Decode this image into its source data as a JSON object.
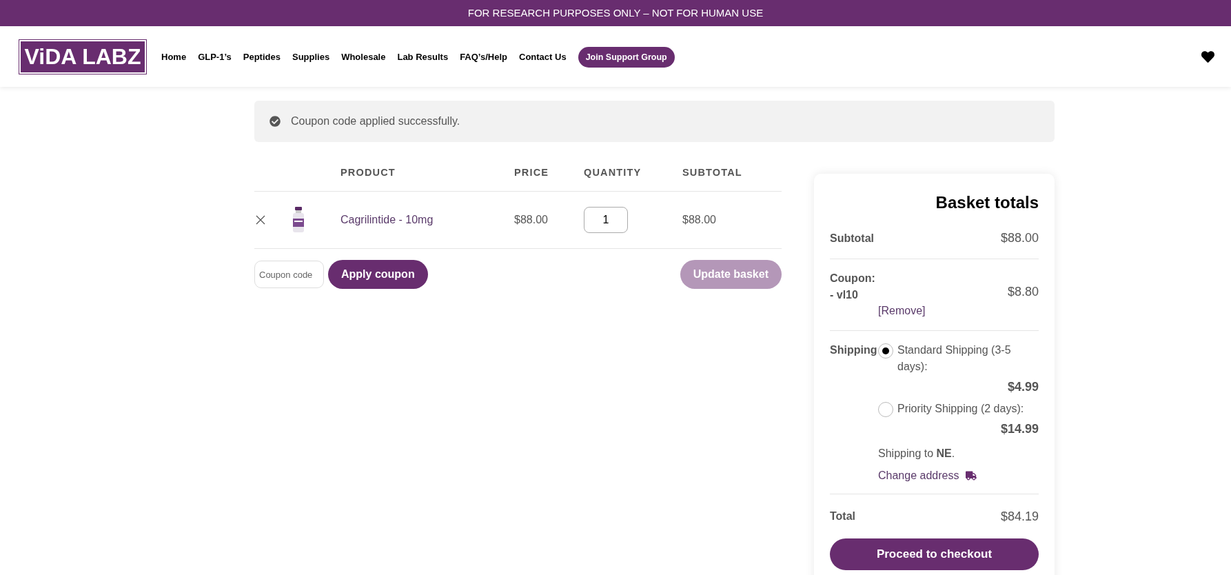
{
  "banner": "FOR RESEARCH PURPOSES ONLY – NOT FOR HUMAN USE",
  "logo": "ViDA LABZ",
  "nav": [
    {
      "label": "Home"
    },
    {
      "label": "GLP-1’s"
    },
    {
      "label": "Peptides"
    },
    {
      "label": "Supplies"
    },
    {
      "label": "Wholesale"
    },
    {
      "label": "Lab Results"
    },
    {
      "label": "FAQ’s/Help"
    },
    {
      "label": "Contact Us"
    }
  ],
  "nav_button": "Join Support Group",
  "notice": "Coupon code applied successfully.",
  "cart": {
    "columns": [
      "PRODUCT",
      "PRICE",
      "QUANTITY",
      "SUBTOTAL"
    ],
    "rows": [
      {
        "product": "Cagrilintide - 10mg",
        "price": "$88.00",
        "quantity": "1",
        "subtotal": "$88.00"
      }
    ]
  },
  "coupon": {
    "placeholder": "Coupon code",
    "apply": "Apply coupon",
    "update": "Update basket",
    "update_disabled": true
  },
  "totals": {
    "title": "Basket totals",
    "subtotal_label": "Subtotal",
    "subtotal": "$88.00",
    "coupon_label": "Coupon: - vl10",
    "coupon_amount": "$8.80",
    "remove": "[Remove]",
    "shipping_label": "Shipping",
    "shipping_options": [
      {
        "label": "Standard Shipping (3-5 days):",
        "price": "$4.99",
        "selected": true
      },
      {
        "label": "Priority Shipping (2 days):",
        "price": "$14.99",
        "selected": false
      }
    ],
    "shipping_to": "Shipping to **NE**.",
    "change_address": "Change address",
    "total_label": "Total",
    "total": "$84.19",
    "checkout": "Proceed to checkout"
  }
}
